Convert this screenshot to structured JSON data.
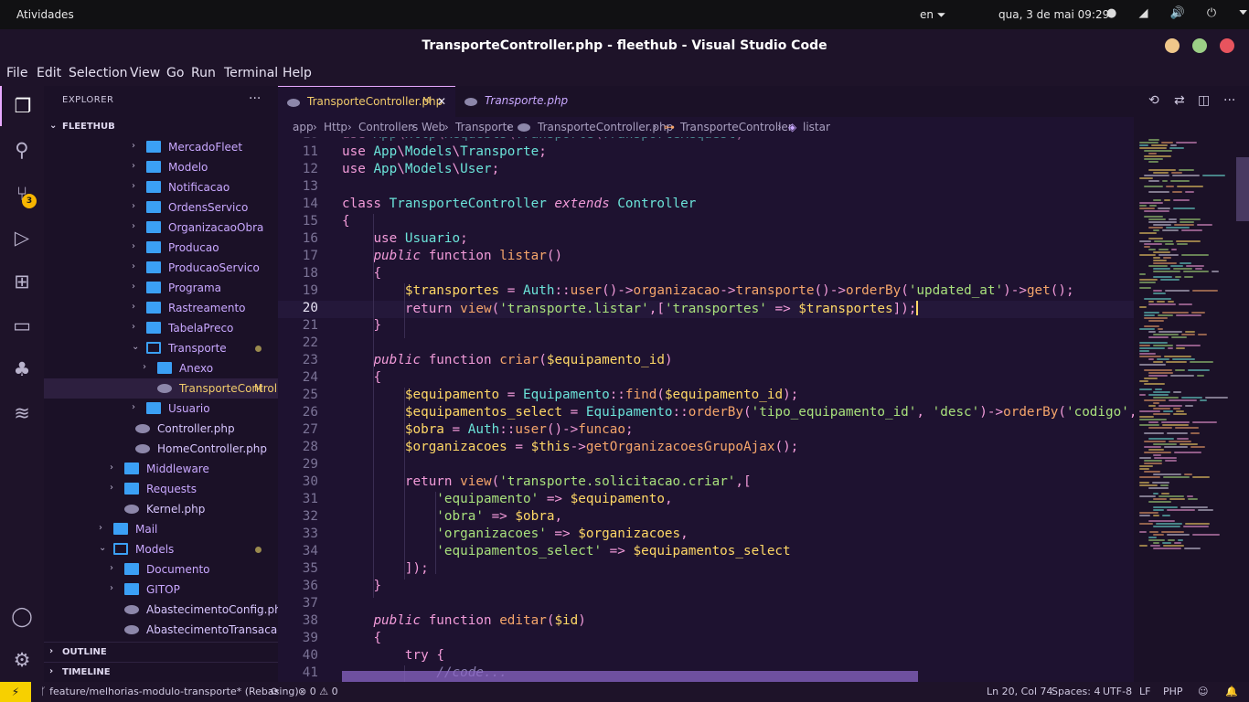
{
  "topbar": {
    "activities": "Atividades",
    "lang": "en ⏷",
    "clock": "qua, 3 de mai  09:29",
    "tray": "● ◢ 🔊 ⏻ ⏷"
  },
  "window": {
    "title": "TransporteController.php - fleethub - Visual Studio Code",
    "buttons": [
      "#f0c78a",
      "#9ccf86",
      "#e8545e"
    ]
  },
  "menu": [
    "File",
    "Edit",
    "Selection",
    "View",
    "Go",
    "Run",
    "Terminal",
    "Help"
  ],
  "activity": {
    "icons": [
      "files-icon",
      "search-icon",
      "source-control-icon",
      "run-debug-icon",
      "extensions-icon",
      "remote-explorer-icon",
      "tree-icon",
      "docker-icon"
    ],
    "badge": "3",
    "bottom": [
      "account-icon",
      "settings-gear-icon"
    ]
  },
  "sidebar": {
    "header": "EXPLORER",
    "more": "···",
    "root": "FLEETHUB",
    "items": [
      {
        "label": "MercadoFleet",
        "type": "folder"
      },
      {
        "label": "Modelo",
        "type": "folder"
      },
      {
        "label": "Notificacao",
        "type": "folder"
      },
      {
        "label": "OrdensServico",
        "type": "folder"
      },
      {
        "label": "OrganizacaoObra",
        "type": "folder"
      },
      {
        "label": "Producao",
        "type": "folder"
      },
      {
        "label": "ProducaoServico",
        "type": "folder"
      },
      {
        "label": "Programa",
        "type": "folder"
      },
      {
        "label": "Rastreamento",
        "type": "folder"
      },
      {
        "label": "TabelaPreco",
        "type": "folder"
      },
      {
        "label": "Transporte",
        "type": "folder-open"
      },
      {
        "label": "Anexo",
        "type": "folder"
      },
      {
        "label": "TransporteController.php",
        "type": "php"
      },
      {
        "label": "Usuario",
        "type": "folder"
      },
      {
        "label": "Controller.php",
        "type": "php"
      },
      {
        "label": "HomeController.php",
        "type": "php"
      },
      {
        "label": "Middleware",
        "type": "folder"
      },
      {
        "label": "Requests",
        "type": "folder"
      },
      {
        "label": "Kernel.php",
        "type": "php"
      },
      {
        "label": "Mail",
        "type": "folder"
      },
      {
        "label": "Models",
        "type": "folder-open"
      },
      {
        "label": "Documento",
        "type": "folder"
      },
      {
        "label": "GITOP",
        "type": "folder"
      },
      {
        "label": "AbastecimentoConfig.php",
        "type": "php"
      },
      {
        "label": "AbastecimentoTransacao.php",
        "type": "php"
      }
    ],
    "modified_mark": "M",
    "outline": "OUTLINE",
    "timeline": "TIMELINE"
  },
  "tabs": [
    {
      "label": "TransporteController.php",
      "badge": "M",
      "close": "✕",
      "active": true
    },
    {
      "label": "Transporte.php",
      "active": false
    }
  ],
  "breadcrumb": [
    "app",
    "Http",
    "Controllers",
    "Web",
    "Transporte",
    "TransporteController.php",
    "TransporteController",
    "listar"
  ],
  "editor": {
    "current_line": "20",
    "lines": [
      {
        "n": "10",
        "text": "use App\\Http\\Requests\\Transporte\\TransporteRequest;"
      },
      {
        "n": "11",
        "text": "use App\\Models\\Transporte;"
      },
      {
        "n": "12",
        "text": "use App\\Models\\User;"
      },
      {
        "n": "13",
        "text": ""
      },
      {
        "n": "14",
        "text": "class TransporteController extends Controller"
      },
      {
        "n": "15",
        "text": "{"
      },
      {
        "n": "16",
        "text": "    use Usuario;"
      },
      {
        "n": "17",
        "text": "    public function listar()"
      },
      {
        "n": "18",
        "text": "    {"
      },
      {
        "n": "19",
        "text": "        $transportes = Auth::user()->organizacao->transporte()->orderBy('updated_at')->get();"
      },
      {
        "n": "20",
        "text": "        return view('transporte.listar',['transportes' => $transportes]);"
      },
      {
        "n": "21",
        "text": "    }"
      },
      {
        "n": "22",
        "text": ""
      },
      {
        "n": "23",
        "text": "    public function criar($equipamento_id)"
      },
      {
        "n": "24",
        "text": "    {"
      },
      {
        "n": "25",
        "text": "        $equipamento = Equipamento::find($equipamento_id);"
      },
      {
        "n": "26",
        "text": "        $equipamentos_select = Equipamento::orderBy('tipo_equipamento_id', 'desc')->orderBy('codigo', '"
      },
      {
        "n": "27",
        "text": "        $obra = Auth::user()->funcao;"
      },
      {
        "n": "28",
        "text": "        $organizacoes = $this->getOrganizacoesGrupoAjax();"
      },
      {
        "n": "29",
        "text": ""
      },
      {
        "n": "30",
        "text": "        return view('transporte.solicitacao.criar',["
      },
      {
        "n": "31",
        "text": "            'equipamento' => $equipamento,"
      },
      {
        "n": "32",
        "text": "            'obra' => $obra,"
      },
      {
        "n": "33",
        "text": "            'organizacoes' => $organizacoes,"
      },
      {
        "n": "34",
        "text": "            'equipamentos_select' => $equipamentos_select"
      },
      {
        "n": "35",
        "text": "        ]);"
      },
      {
        "n": "36",
        "text": "    }"
      },
      {
        "n": "37",
        "text": ""
      },
      {
        "n": "38",
        "text": "    public function editar($id)"
      },
      {
        "n": "39",
        "text": "    {"
      },
      {
        "n": "40",
        "text": "        try {"
      },
      {
        "n": "41",
        "text": "            //code..."
      }
    ]
  },
  "statusbar": {
    "remote": "⚡",
    "branch": "ᚴ feature/melhorias-modulo-transporte* (Rebasing)",
    "sync": "⟳",
    "problems": "⊗ 0 ⚠ 0",
    "cursor": "Ln 20, Col 74",
    "spaces": "Spaces: 4",
    "encoding": "UTF-8",
    "eol": "LF",
    "language": "PHP",
    "feedback": "☺",
    "bell": "🔔"
  }
}
